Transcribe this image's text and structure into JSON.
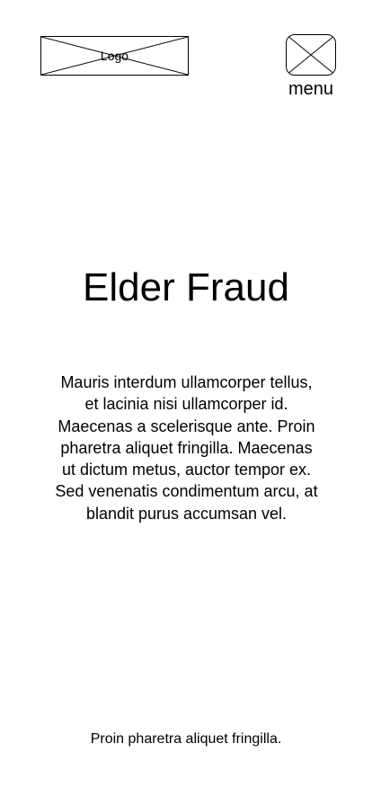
{
  "header": {
    "logo_label": "Logo",
    "menu_label": "menu"
  },
  "main": {
    "title": "Elder Fraud",
    "body": "Mauris interdum ullamcorper tellus, et lacinia nisi ullamcorper id. Maecenas a scelerisque ante. Proin pharetra aliquet fringilla. Maecenas ut dictum metus, auctor tempor ex. Sed venenatis condimentum arcu, at blandit purus accumsan vel."
  },
  "footer": {
    "text": "Proin pharetra aliquet fringilla."
  },
  "icons": {
    "logo": "image-placeholder-icon",
    "menu": "image-placeholder-icon"
  }
}
